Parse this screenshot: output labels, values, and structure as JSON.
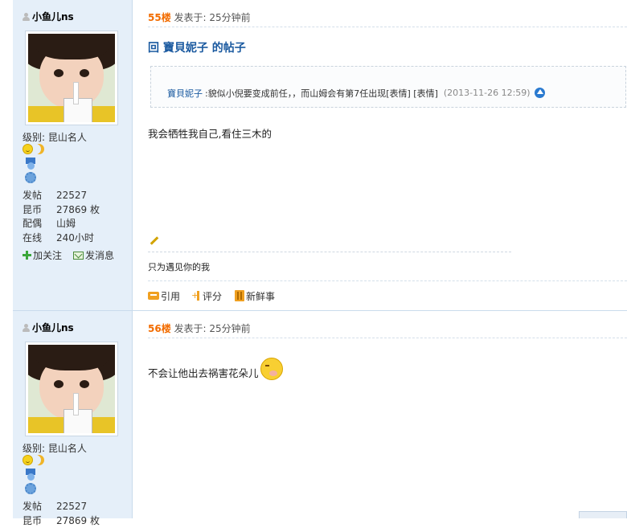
{
  "posts": [
    {
      "username": "小鱼儿ns",
      "level_label": "级别: 昆山名人",
      "stats": [
        {
          "key": "发帖",
          "value": "22527"
        },
        {
          "key": "昆币",
          "value": "27869 枚"
        },
        {
          "key": "配偶",
          "value": "山姆"
        },
        {
          "key": "在线",
          "value": "240小时"
        }
      ],
      "follow_label": "加关注",
      "message_label": "发消息",
      "floor": "55楼",
      "posted_at": "发表于: 25分钟前",
      "title": "回 寶貝妮子 的帖子",
      "quote": {
        "author": "寶貝妮子",
        "text": ":貌似小倪要变成前任，，而山姆会有第7任出现[表情] [表情]",
        "time": "(2013-11-26 12:59)"
      },
      "content": "我会牺牲我自己,看住三木的",
      "signature": "只为遇见你的我",
      "footer": {
        "quote_label": "引用",
        "rate_label": "评分",
        "fresh_label": "新鲜事"
      }
    },
    {
      "username": "小鱼儿ns",
      "level_label": "级别: 昆山名人",
      "stats": [
        {
          "key": "发帖",
          "value": "22527"
        },
        {
          "key": "昆币",
          "value": "27869 枚"
        }
      ],
      "floor": "56楼",
      "posted_at": "发表于: 25分钟前",
      "content": "不会让他出去祸害花朵儿"
    }
  ],
  "colors": {
    "accent": "#1b5aa0",
    "floor": "#f26c00",
    "sidebar": "#e5eff9"
  },
  "icons": [
    "user-icon",
    "smile-icon",
    "moon-icon",
    "medal-icon",
    "plus-icon",
    "mail-icon",
    "up-arrow-icon",
    "pencil-icon",
    "quote-icon",
    "rate-icon",
    "fresh-icon",
    "emoji-icon"
  ]
}
